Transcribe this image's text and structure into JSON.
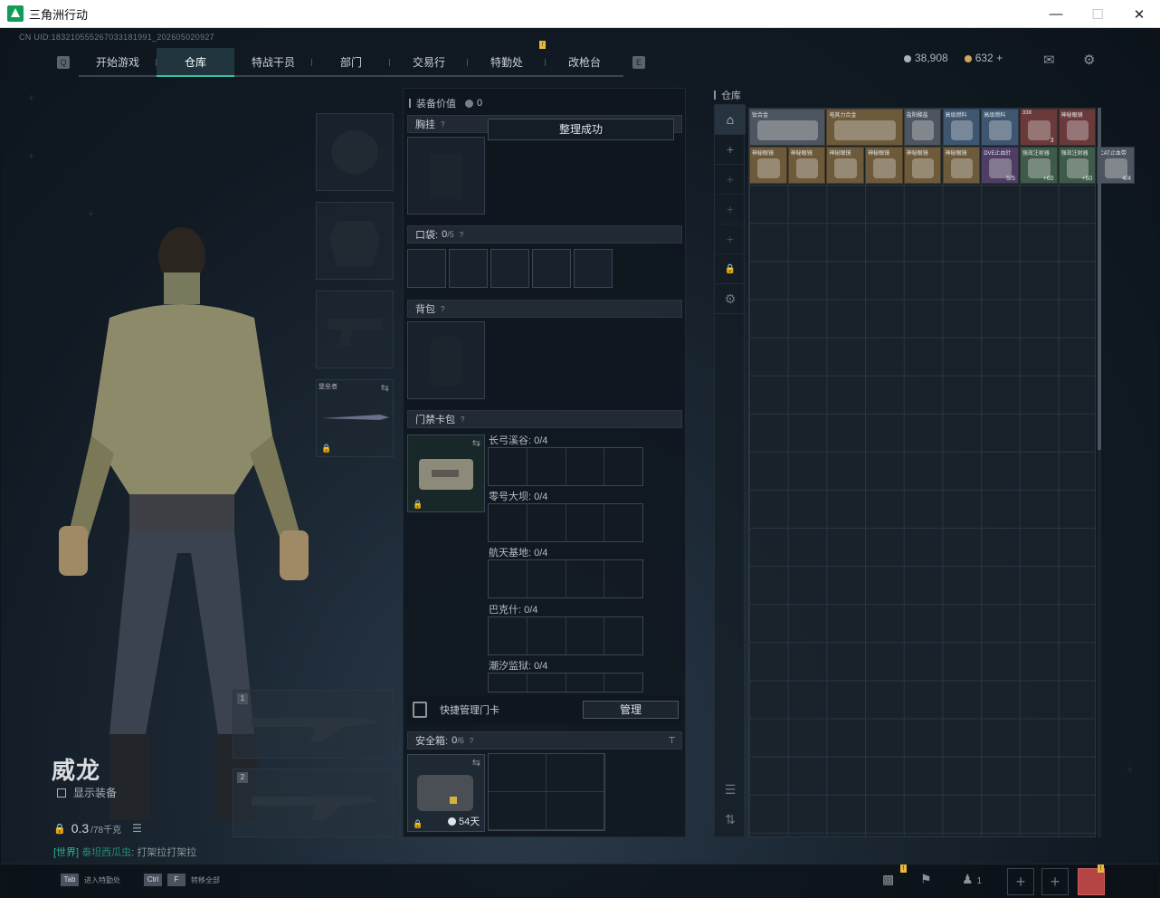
{
  "window": {
    "title": "三角洲行动"
  },
  "uid": "CN UID:1832105552670331819​91_202605020927",
  "nav": {
    "tabs": [
      "开始游戏",
      "仓库",
      "特战干员",
      "部门",
      "交易行",
      "特勤处",
      "改枪台"
    ],
    "active_index": 1,
    "badge": "!"
  },
  "currency": {
    "silver": "38,908",
    "gold": "632",
    "plus": "+"
  },
  "character": {
    "name": "威龙",
    "show_equipment": "显示装备",
    "weight_value": "0.3",
    "weight_max": "/78千克"
  },
  "chat": {
    "channel": "[世界]",
    "sender": "泰坦西瓜虫",
    "message": "打架拉打架拉"
  },
  "equip_slots": {
    "melee_label": "堡垒者"
  },
  "weapon_slots": [
    "1",
    "2"
  ],
  "middle": {
    "value_label": "装备价值",
    "value": "0",
    "toast": "整理成功",
    "chest_rig": "胸挂",
    "pocket_label": "口袋:",
    "pocket_count": "0",
    "pocket_max": "/5",
    "backpack": "背包",
    "keycard_pack": "门禁卡包",
    "card_areas": [
      {
        "name": "长弓溪谷: 0/4"
      },
      {
        "name": "零号大坝: 0/4"
      },
      {
        "name": "航天基地: 0/4"
      },
      {
        "name": "巴克什: 0/4"
      },
      {
        "name": "潮汐监狱: 0/4"
      }
    ],
    "quick_manage": "快捷管理门卡",
    "manage_button": "管理",
    "safe_box": "安全箱:",
    "safe_count": "0",
    "safe_max": "/6",
    "safe_days": "54天",
    "question": "?"
  },
  "warehouse": {
    "title": "仓库",
    "items": [
      {
        "name": "钛合金",
        "qty": "",
        "color": "gray"
      },
      {
        "name": "电其力合金",
        "qty": "",
        "color": "gold"
      },
      {
        "name": "盐阳酸盐",
        "qty": "",
        "color": "gray"
      },
      {
        "name": "高级燃料",
        "qty": "",
        "color": "blue"
      },
      {
        "name": "高级燃料",
        "qty": "",
        "color": "blue"
      },
      {
        "name": "338",
        "qty": "3",
        "color": "red"
      },
      {
        "name": "神秘眼镜",
        "qty": "",
        "color": "red"
      },
      {
        "name": "神秘眼镜",
        "qty": "",
        "color": "gold"
      },
      {
        "name": "神秘眼镜",
        "qty": "",
        "color": "gold"
      },
      {
        "name": "神秘眼镜",
        "qty": "",
        "color": "gold"
      },
      {
        "name": "神秘眼镜",
        "qty": "",
        "color": "gold"
      },
      {
        "name": "神秘眼镜",
        "qty": "",
        "color": "gold"
      },
      {
        "name": "神秘眼镜",
        "qty": "",
        "color": "gold"
      },
      {
        "name": "DVE止血针",
        "qty": "5/5",
        "color": "purple"
      },
      {
        "name": "强效注射器",
        "qty": "+60",
        "color": "green"
      },
      {
        "name": "强效注射器",
        "qty": "+60",
        "color": "green"
      },
      {
        "name": "CAT止血带",
        "qty": "4/4",
        "color": "gray"
      }
    ]
  },
  "bottom": {
    "tab_key": "Tab",
    "tab_hint": "进入特勤处",
    "ctrl_key": "Ctrl",
    "f_key": "F",
    "ctrl_hint": "转移全部",
    "friends_count": "1",
    "plus": "+"
  },
  "icons": [
    "warehouse-icon",
    "plus-icon",
    "lock-icon",
    "gear-icon",
    "layers-icon",
    "sort-icon",
    "mail-icon",
    "settings-icon",
    "chart-icon",
    "flag-icon",
    "friends-icon",
    "swap-icon",
    "clock-icon"
  ]
}
